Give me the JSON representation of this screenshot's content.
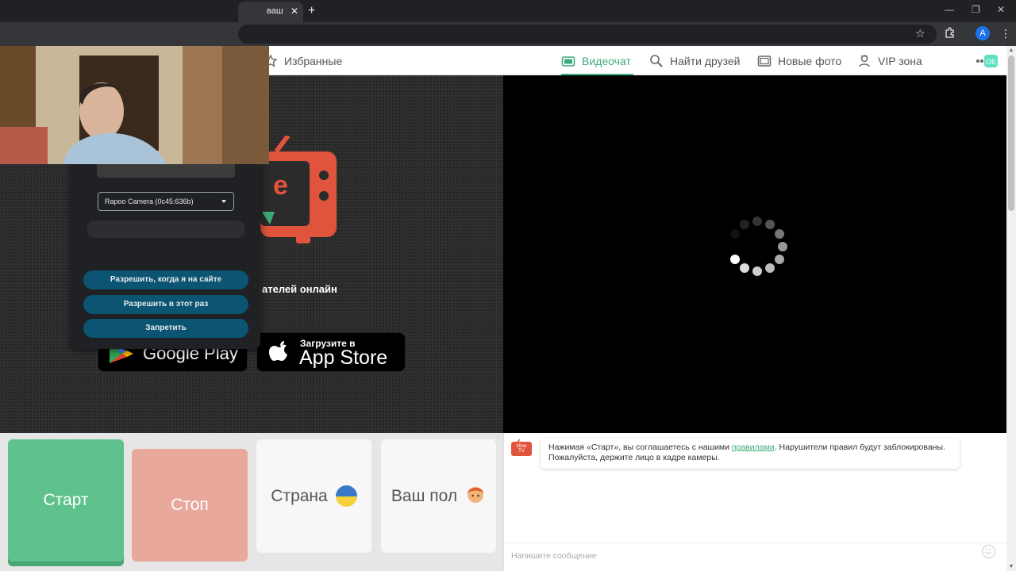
{
  "browser": {
    "tab_title": "ваш",
    "tab_close": "✕",
    "newtab": "+",
    "win_min": "—",
    "win_max": "❐",
    "win_close": "✕"
  },
  "header": {
    "favorites": "Избранные",
    "videochat": "Видеочат",
    "find_friends": "Найти друзей",
    "new_photos": "Новые фото",
    "vip": "VIP зона"
  },
  "left": {
    "online_text": "ателей онлайн",
    "google_play": "Google Play",
    "appstore_small": "Загрузите в",
    "appstore_big": "App Store"
  },
  "permission_popup": {
    "camera": "Rapoo Camera (0c45:636b)",
    "allow_site": "Разрешить, когда я на сайте",
    "allow_once": "Разрешить в этот раз",
    "deny": "Запретить"
  },
  "controls": {
    "start": "Старт",
    "stop": "Стоп",
    "country": "Страна",
    "gender": "Ваш пол"
  },
  "chat": {
    "msg_before": "Нажимая «Старт», вы соглашаетесь с нашими ",
    "msg_link": "правилами",
    "msg_after": ". Нарушители правил будут заблокированы. Пожалуйста, держите лицо в кадре камеры.",
    "logo_text": "Ome TV",
    "input_placeholder": "Напишите сообщение"
  },
  "colors": {
    "accent": "#3daa79",
    "start": "#5fc28d",
    "stop": "#e8a89c"
  }
}
